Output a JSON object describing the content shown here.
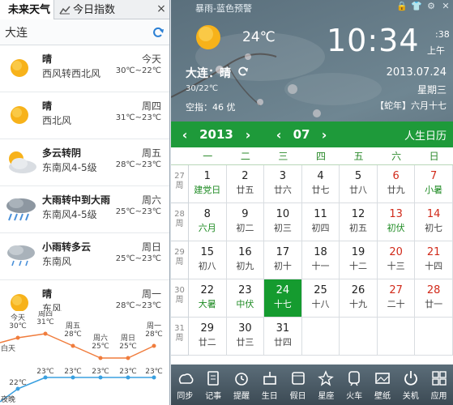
{
  "left": {
    "tabs": {
      "weather": "未来天气",
      "index": "今日指数",
      "close": "×"
    },
    "city": "大连",
    "forecast": [
      {
        "cond": "晴",
        "wind": "西风转西北风",
        "dow": "今天",
        "temp": "30℃~22℃",
        "icon": "sun-icon"
      },
      {
        "cond": "晴",
        "wind": "西北风",
        "dow": "周四",
        "temp": "31℃~23℃",
        "icon": "sun-icon"
      },
      {
        "cond": "多云转阴",
        "wind": "东南风4-5级",
        "dow": "周五",
        "temp": "28℃~23℃",
        "icon": "cloudy-icon"
      },
      {
        "cond": "大雨转中到大雨",
        "wind": "东南风4-5级",
        "dow": "周六",
        "temp": "25℃~23℃",
        "icon": "heavy-rain-icon"
      },
      {
        "cond": "小雨转多云",
        "wind": "东南风",
        "dow": "周日",
        "temp": "25℃~23℃",
        "icon": "light-rain-icon"
      },
      {
        "cond": "晴",
        "wind": "东风",
        "dow": "周一",
        "temp": "28℃~23℃",
        "icon": "sun-icon"
      }
    ],
    "trend": {
      "days": [
        "今天",
        "周四",
        "周五",
        "周六",
        "周日",
        "周一"
      ],
      "highs_text": [
        "30℃",
        "31℃",
        "28℃",
        "25℃",
        "25℃",
        "28℃"
      ],
      "lows_text": [
        "22℃",
        "23℃",
        "23℃",
        "23℃",
        "23℃",
        "23℃"
      ],
      "highs": [
        30,
        31,
        28,
        25,
        25,
        28
      ],
      "lows": [
        22,
        23,
        23,
        23,
        23,
        23
      ],
      "prev_label": "白天",
      "prev_low_label": "夜晚",
      "high_color": "#f07c3c",
      "low_color": "#3aa0e0"
    }
  },
  "right": {
    "title": "暴雨-蓝色预警",
    "current": {
      "temp": "24℃",
      "city": "大连：晴",
      "range": "30/22℃",
      "air_label": "空指：",
      "air_value": "46 优"
    },
    "clock": {
      "time": "10:34",
      "sec": ":38",
      "ampm": "上午"
    },
    "date": "2013.07.24",
    "weekday": "星期三",
    "lunar": "【蛇年】六月十七",
    "calendar": {
      "year": "2013",
      "month": "07",
      "life": "人生日历",
      "weekday_headers": [
        "一",
        "二",
        "三",
        "四",
        "五",
        "六",
        "日"
      ],
      "weeks": [
        {
          "wk": "27",
          "days": [
            [
              "1",
              "建党日",
              1
            ],
            [
              "2",
              "廿五",
              0
            ],
            [
              "3",
              "廿六",
              0
            ],
            [
              "4",
              "廿七",
              0
            ],
            [
              "5",
              "廿八",
              0
            ],
            [
              "6",
              "廿九",
              0
            ],
            [
              "7",
              "小暑",
              1
            ]
          ]
        },
        {
          "wk": "28",
          "days": [
            [
              "8",
              "六月",
              1
            ],
            [
              "9",
              "初二",
              0
            ],
            [
              "10",
              "初三",
              0
            ],
            [
              "11",
              "初四",
              0
            ],
            [
              "12",
              "初五",
              0
            ],
            [
              "13",
              "初伏",
              1
            ],
            [
              "14",
              "初七",
              0
            ]
          ]
        },
        {
          "wk": "29",
          "days": [
            [
              "15",
              "初八",
              0
            ],
            [
              "16",
              "初九",
              0
            ],
            [
              "17",
              "初十",
              0
            ],
            [
              "18",
              "十一",
              0
            ],
            [
              "19",
              "十二",
              0
            ],
            [
              "20",
              "十三",
              0
            ],
            [
              "21",
              "十四",
              0
            ]
          ]
        },
        {
          "wk": "30",
          "days": [
            [
              "22",
              "大暑",
              1
            ],
            [
              "23",
              "中伏",
              1
            ],
            [
              "24",
              "十七",
              0
            ],
            [
              "25",
              "十八",
              0
            ],
            [
              "26",
              "十九",
              0
            ],
            [
              "27",
              "二十",
              0
            ],
            [
              "28",
              "廿一",
              0
            ]
          ]
        },
        {
          "wk": "31",
          "days": [
            [
              "29",
              "廿二",
              0
            ],
            [
              "30",
              "廿三",
              0
            ],
            [
              "31",
              "廿四",
              0
            ],
            [
              "",
              "",
              0
            ],
            [
              "",
              "",
              0
            ],
            [
              "",
              "",
              0
            ],
            [
              "",
              "",
              0
            ]
          ]
        }
      ],
      "today": "24",
      "week_label": "周"
    },
    "toolbar": [
      "同步",
      "记事",
      "提醒",
      "生日",
      "假日",
      "星座",
      "火车",
      "壁纸",
      "关机",
      "应用"
    ],
    "colors": {
      "green": "#1e9a3a",
      "today": "#159b2f",
      "holiday": "#d12a1a",
      "term": "#1d8a22"
    }
  }
}
